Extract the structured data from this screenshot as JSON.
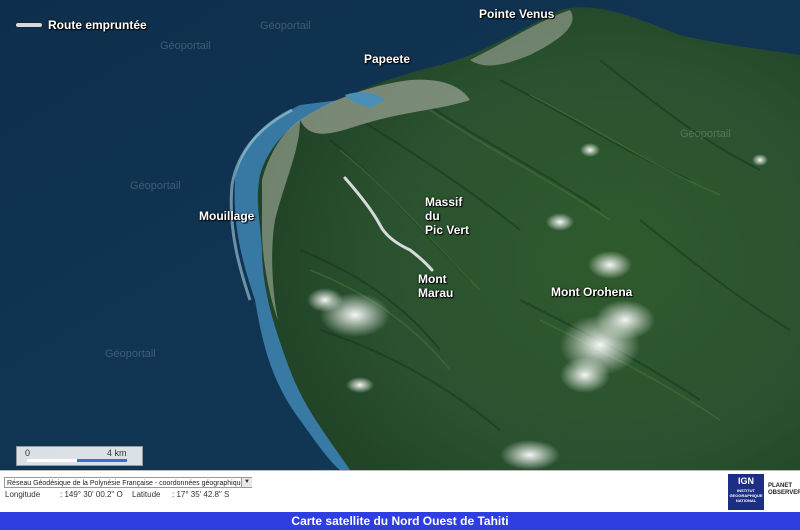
{
  "legend": {
    "label": "Route empruntée"
  },
  "places": [
    {
      "name": "Pointe Venus"
    },
    {
      "name": "Papeete"
    },
    {
      "name": "Mouillage"
    },
    {
      "name": "Massif du Pic Vert",
      "lines": [
        "Massif",
        "du",
        "Pic Vert"
      ]
    },
    {
      "name": "Mont Marau",
      "lines": [
        "Mont",
        "Marau"
      ]
    },
    {
      "name": "Mont Orohena"
    }
  ],
  "watermark": "Géoportail",
  "scale": {
    "start": "0",
    "end": "4 km"
  },
  "infobar": {
    "crs_select": "Réseau Géodésique de la Polynésie Française - coordonnées géographiques",
    "longitude_label": "Longitude",
    "longitude_value": ": 149° 30' 00.2\" O",
    "latitude_label": "Latitude",
    "latitude_value": ": 17° 35' 42.8\" S"
  },
  "logos": {
    "ign": "IGN",
    "ign_sub": "INSTITUT GEOGRAPHIQUE NATIONAL",
    "planet": "PLANET OBSERVER"
  },
  "caption": "Carte satellite du Nord Ouest de Tahiti",
  "colors": {
    "route": "#d9d9d9",
    "caption_bg": "#2f3ee0",
    "scale_bar": "#3a70c8"
  }
}
